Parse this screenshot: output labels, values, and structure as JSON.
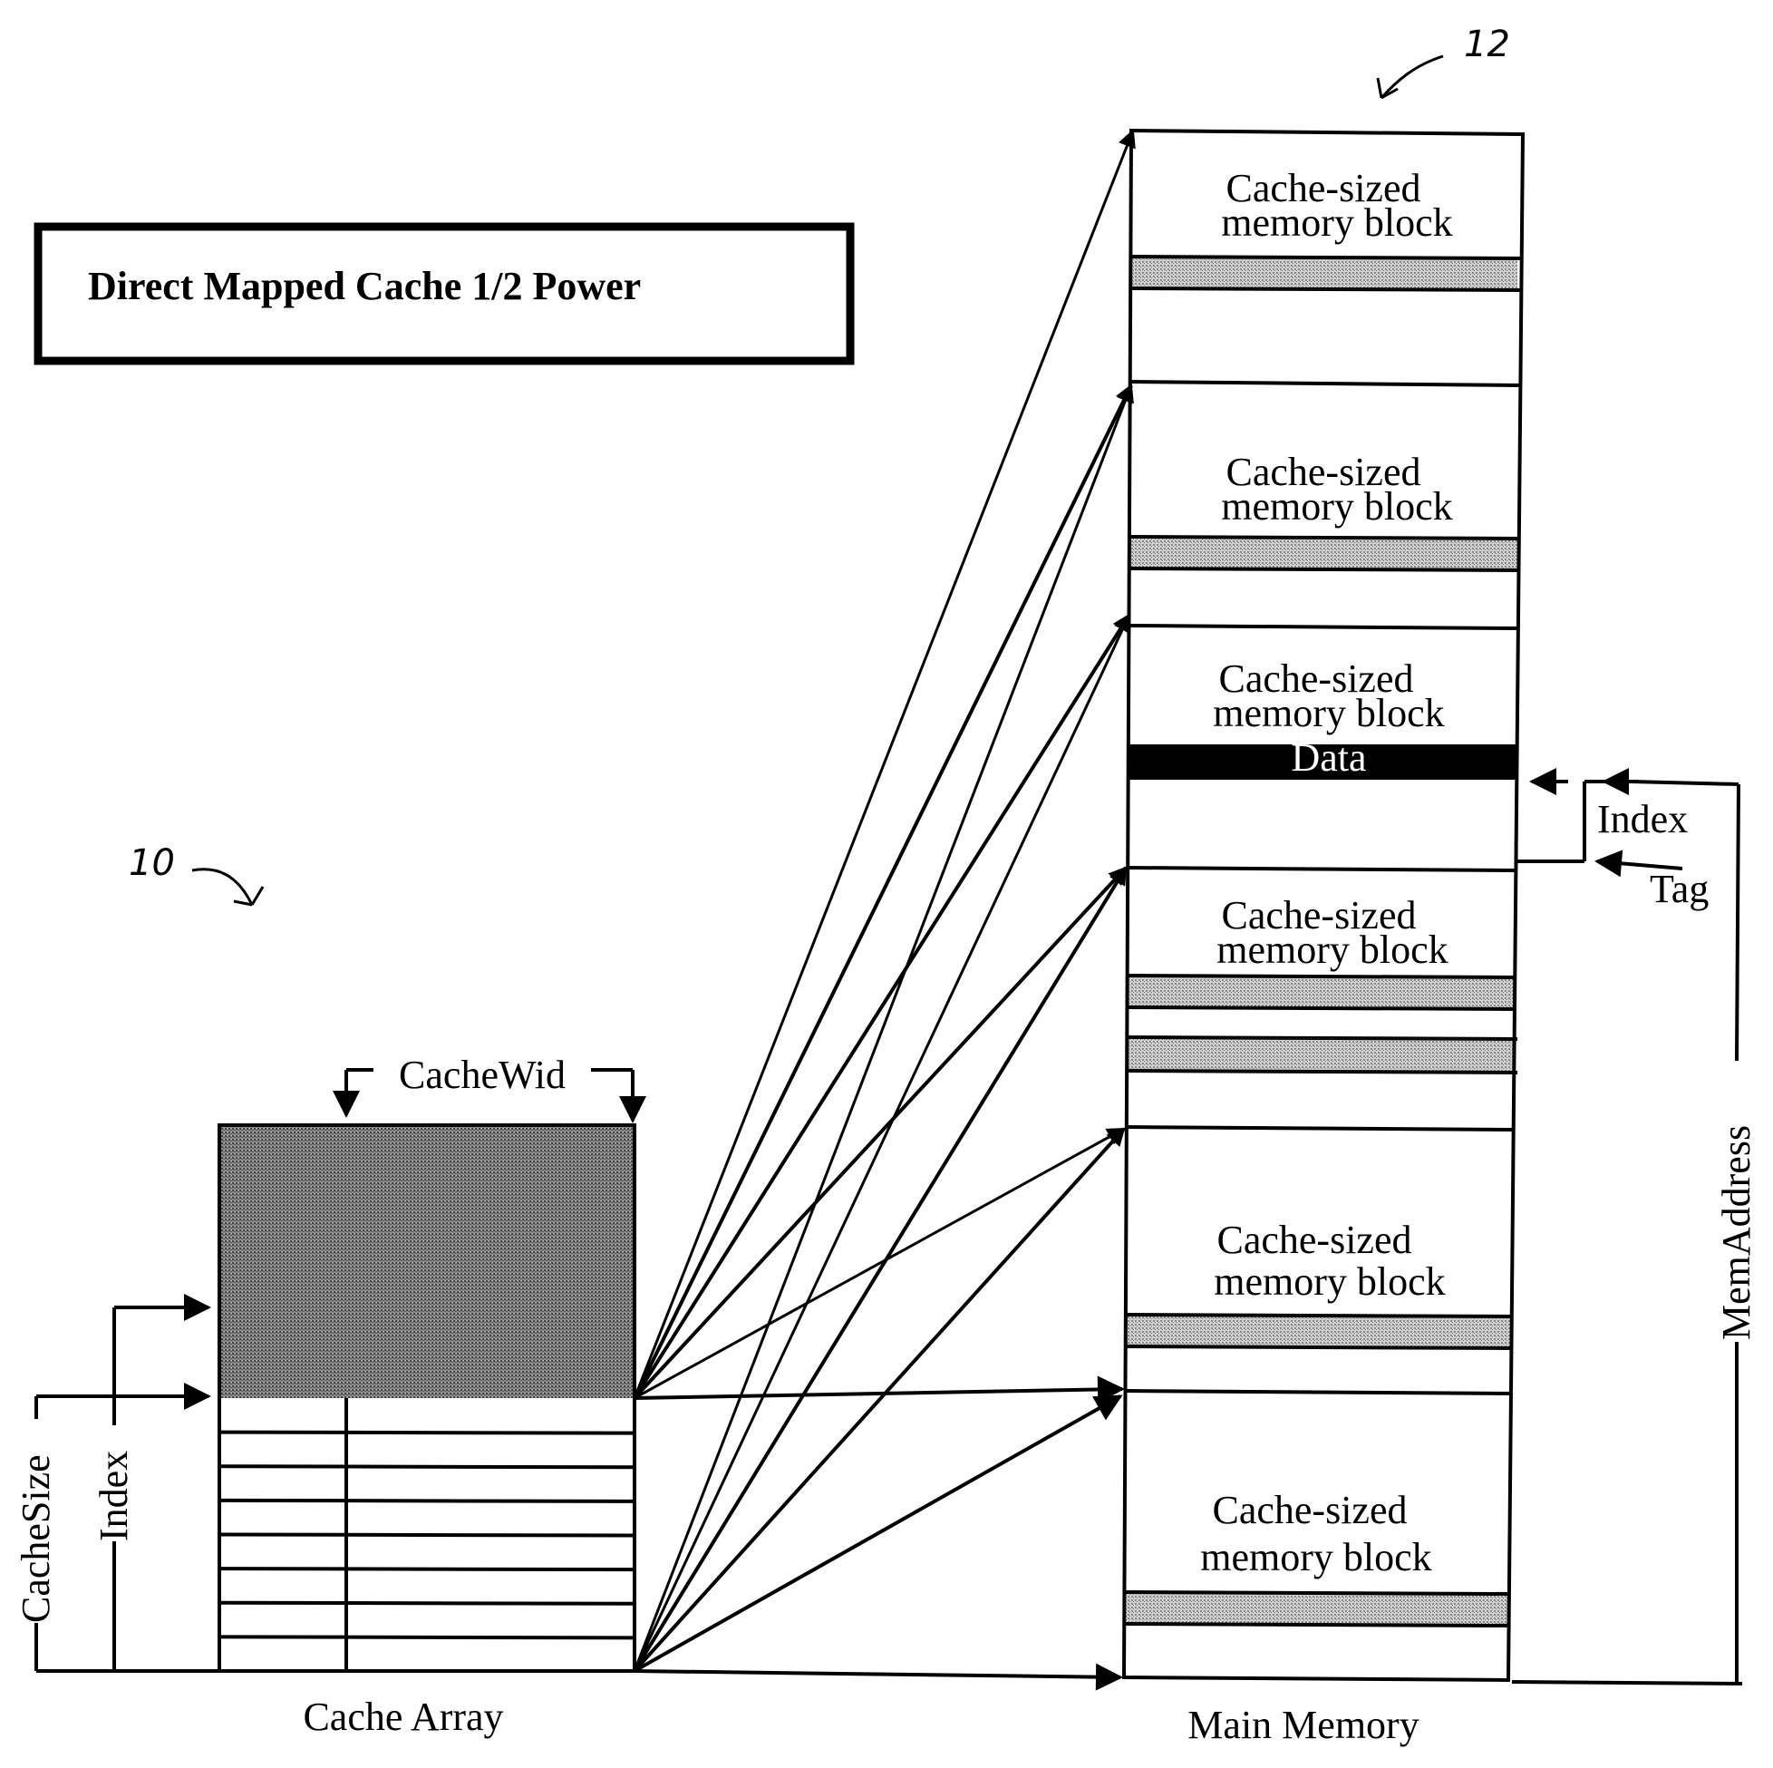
{
  "title": "Direct Mapped Cache 1/2 Power",
  "reference_numerals": {
    "cache": "10",
    "memory": "12"
  },
  "cache_array": {
    "label": "Cache Array",
    "width_label": "CacheWid",
    "size_label": "CacheSize",
    "index_label": "Index",
    "row_count": 8
  },
  "main_memory": {
    "label": "Main Memory",
    "address_label": "MemAddress",
    "index_label": "Index",
    "tag_label": "Tag",
    "data_label": "Data",
    "blocks": [
      {
        "line1": "Cache-sized",
        "line2": "memory block"
      },
      {
        "line1": "Cache-sized",
        "line2": "memory block"
      },
      {
        "line1": "Cache-sized",
        "line2": "memory block"
      },
      {
        "line1": "Cache-sized",
        "line2": "memory block"
      },
      {
        "line1": "Cache-sized",
        "line2": "memory block"
      },
      {
        "line1": "Cache-sized",
        "line2": "memory block"
      }
    ]
  },
  "colors": {
    "ink": "#000000",
    "paper": "#ffffff",
    "light_shade": "#b8b8b8",
    "dark_shade": "#6e6e6e"
  }
}
